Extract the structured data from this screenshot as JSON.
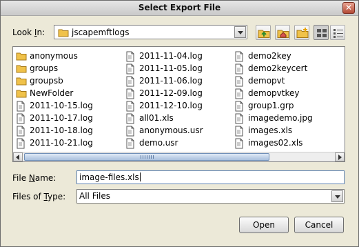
{
  "dialog": {
    "title": "Select Export File"
  },
  "look_in": {
    "label_pre": "Look ",
    "label_mnemonic": "I",
    "label_post": "n:",
    "value": "jscapemftlogs"
  },
  "toolbar": {
    "icons": [
      "up-folder-icon",
      "home-icon",
      "new-folder-icon",
      "list-view-icon",
      "details-view-icon"
    ]
  },
  "files": {
    "columns": [
      [
        {
          "name": "anonymous",
          "type": "folder"
        },
        {
          "name": "groups",
          "type": "folder"
        },
        {
          "name": "groupsb",
          "type": "folder"
        },
        {
          "name": "NewFolder",
          "type": "folder"
        },
        {
          "name": "2011-10-15.log",
          "type": "file"
        },
        {
          "name": "2011-10-17.log",
          "type": "file"
        },
        {
          "name": "2011-10-18.log",
          "type": "file"
        },
        {
          "name": "2011-10-21.log",
          "type": "file"
        }
      ],
      [
        {
          "name": "2011-11-04.log",
          "type": "file"
        },
        {
          "name": "2011-11-05.log",
          "type": "file"
        },
        {
          "name": "2011-11-06.log",
          "type": "file"
        },
        {
          "name": "2011-12-09.log",
          "type": "file"
        },
        {
          "name": "2011-12-10.log",
          "type": "file"
        },
        {
          "name": "all01.xls",
          "type": "file"
        },
        {
          "name": "anonymous.usr",
          "type": "file"
        },
        {
          "name": "demo.usr",
          "type": "file"
        }
      ],
      [
        {
          "name": "demo2key",
          "type": "file"
        },
        {
          "name": "demo2keycert",
          "type": "file"
        },
        {
          "name": "demopvt",
          "type": "file"
        },
        {
          "name": "demopvtkey",
          "type": "file"
        },
        {
          "name": "group1.grp",
          "type": "file"
        },
        {
          "name": "imagedemo.jpg",
          "type": "file"
        },
        {
          "name": "images.xls",
          "type": "file"
        },
        {
          "name": "images02.xls",
          "type": "file"
        }
      ]
    ]
  },
  "file_name": {
    "label_pre": "File ",
    "label_mnemonic": "N",
    "label_post": "ame:",
    "value": "image-files.xls"
  },
  "file_type": {
    "label_pre": "Files of ",
    "label_mnemonic": "T",
    "label_post": "ype:",
    "value": "All Files"
  },
  "buttons": {
    "open": "Open",
    "cancel": "Cancel"
  },
  "colors": {
    "dialog_bg": "#ece9d8",
    "folder": "#f0c24a",
    "scroll_thumb": "#a9c0dd"
  }
}
